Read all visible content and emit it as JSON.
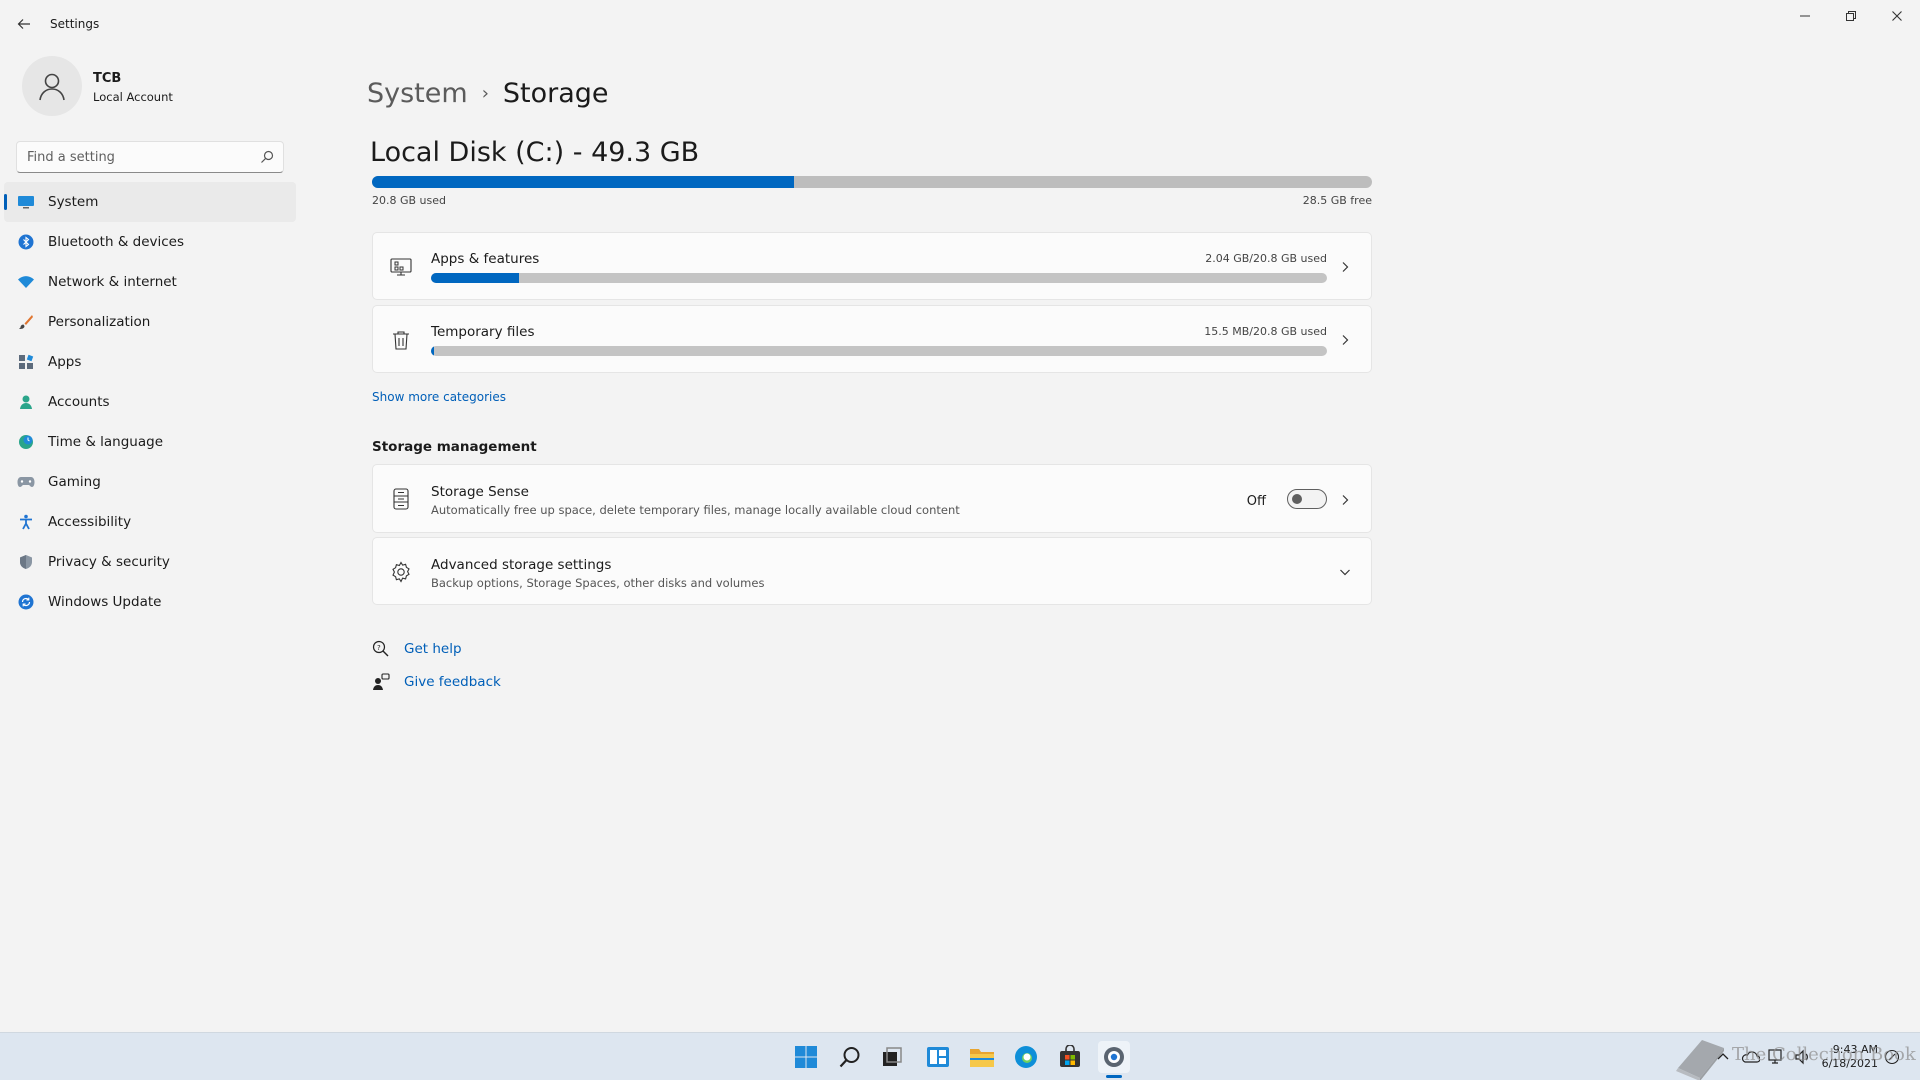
{
  "window": {
    "title": "Settings"
  },
  "profile": {
    "name": "TCB",
    "account_type": "Local Account"
  },
  "search": {
    "placeholder": "Find a setting"
  },
  "sidebar": {
    "items": [
      {
        "label": "System",
        "icon": "system-icon",
        "active": true
      },
      {
        "label": "Bluetooth & devices",
        "icon": "bluetooth-icon"
      },
      {
        "label": "Network & internet",
        "icon": "wifi-icon"
      },
      {
        "label": "Personalization",
        "icon": "brush-icon"
      },
      {
        "label": "Apps",
        "icon": "apps-icon"
      },
      {
        "label": "Accounts",
        "icon": "person-icon"
      },
      {
        "label": "Time & language",
        "icon": "globe-clock-icon"
      },
      {
        "label": "Gaming",
        "icon": "gamepad-icon"
      },
      {
        "label": "Accessibility",
        "icon": "accessibility-icon"
      },
      {
        "label": "Privacy & security",
        "icon": "shield-icon"
      },
      {
        "label": "Windows Update",
        "icon": "update-icon"
      }
    ]
  },
  "breadcrumb": {
    "parent": "System",
    "separator": "›",
    "current": "Storage"
  },
  "disk": {
    "title": "Local Disk (C:) - 49.3 GB",
    "used_label": "20.8 GB used",
    "free_label": "28.5 GB free",
    "used_fraction": 0.422
  },
  "categories": [
    {
      "title": "Apps & features",
      "usage": "2.04 GB/20.8 GB used",
      "fraction": 0.098,
      "icon": "apps-features-icon"
    },
    {
      "title": "Temporary files",
      "usage": "15.5 MB/20.8 GB used",
      "fraction": 0.0007,
      "icon": "trash-icon"
    }
  ],
  "show_more_label": "Show more categories",
  "storage_management": {
    "heading": "Storage management",
    "storage_sense": {
      "title": "Storage Sense",
      "description": "Automatically free up space, delete temporary files, manage locally available cloud content",
      "toggle_label": "Off",
      "toggle_on": false
    },
    "advanced": {
      "title": "Advanced storage settings",
      "description": "Backup options, Storage Spaces, other disks and volumes"
    }
  },
  "help": {
    "get_help": "Get help",
    "give_feedback": "Give feedback"
  },
  "taskbar": {
    "apps": [
      "start-icon",
      "search-icon",
      "task-view-icon",
      "widgets-icon",
      "file-explorer-icon",
      "edge-icon",
      "store-icon",
      "settings-icon"
    ],
    "time": "9:43 AM",
    "date": "6/18/2021"
  },
  "watermark": {
    "text": "The Collection Book"
  },
  "colors": {
    "accent": "#0067c0",
    "link": "#005fb8",
    "bar_track": "#bdbdbd"
  }
}
